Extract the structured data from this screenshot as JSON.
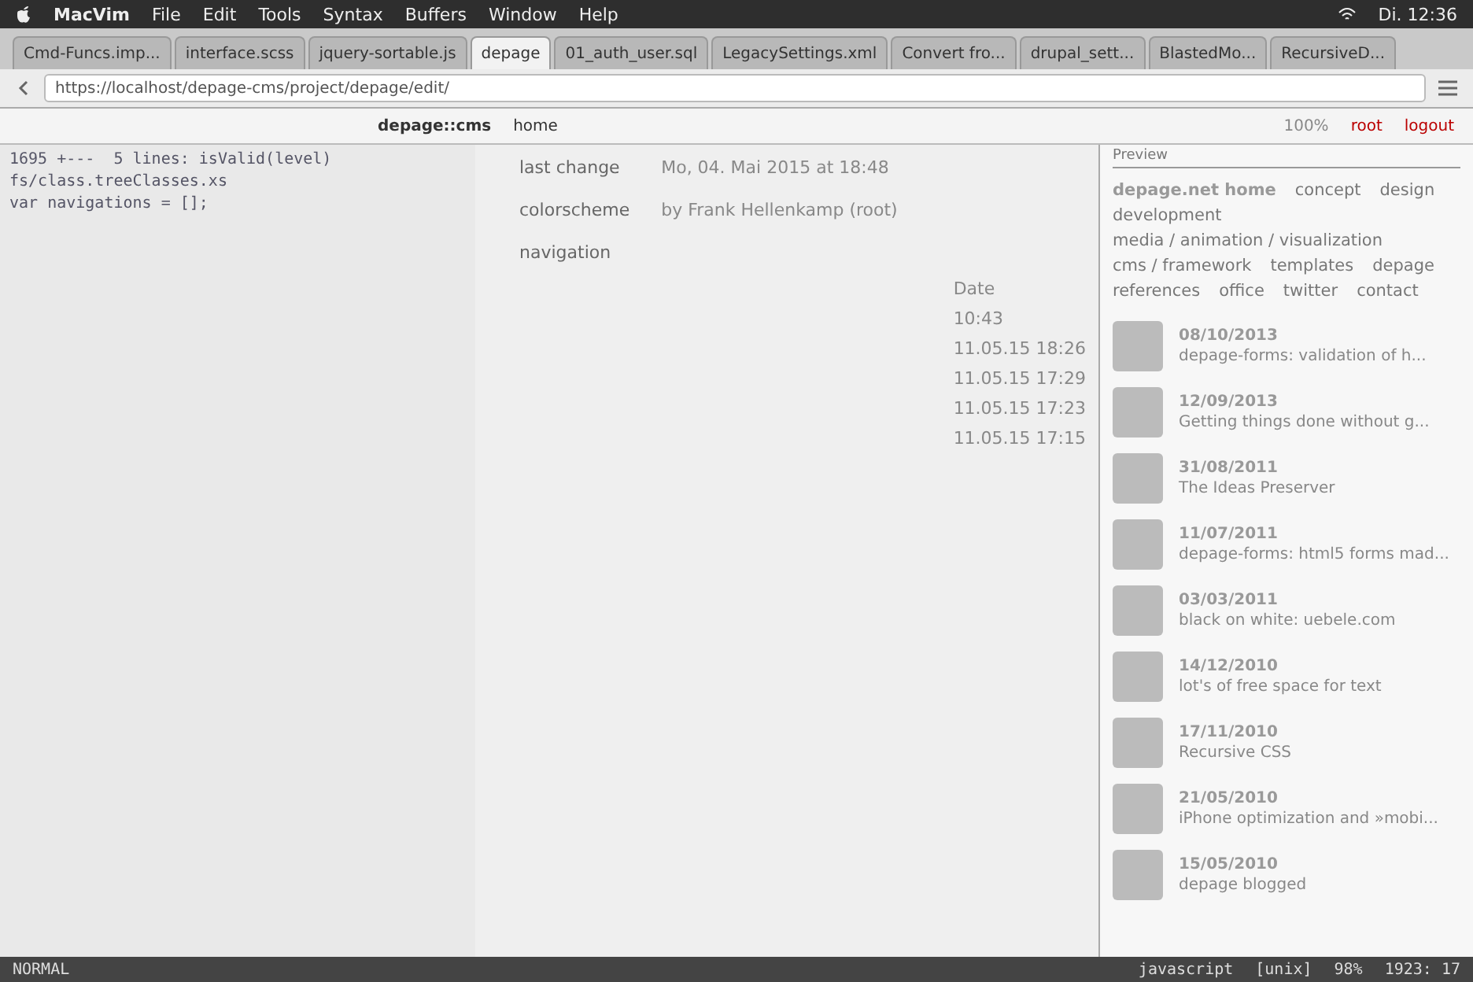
{
  "menubar": {
    "app": "MacVim",
    "menus": [
      "File",
      "Edit",
      "Tools",
      "Syntax",
      "Buffers",
      "Window",
      "Help"
    ],
    "clock": "Di. 12:36"
  },
  "tabs": [
    {
      "label": "Cmd-Funcs.imp...",
      "selected": false
    },
    {
      "label": "interface.scss",
      "selected": false
    },
    {
      "label": "jquery-sortable.js",
      "selected": false
    },
    {
      "label": "depage",
      "selected": true
    },
    {
      "label": "01_auth_user.sql",
      "selected": false
    },
    {
      "label": "LegacySettings.xml",
      "selected": false
    },
    {
      "label": "Convert fro...",
      "selected": false
    },
    {
      "label": "drupal_sett...",
      "selected": false
    },
    {
      "label": "BlastedMo...",
      "selected": false
    },
    {
      "label": "RecursiveD...",
      "selected": false
    }
  ],
  "address_bar": {
    "url": "https://localhost/depage-cms/project/depage/edit/"
  },
  "cms_toolbar": {
    "brand": "depage::cms",
    "home": "home",
    "zoom": "100%",
    "user": "root",
    "logout": "logout"
  },
  "editor": {
    "lines": [
      "1695 +---  5 lines: isValid(level)",
      "fs/class.treeClasses.xs",
      "var navigations = [];"
    ],
    "mode": "NORMAL",
    "filetype": "javascript",
    "format": "[unix]",
    "percent": "98%",
    "position": "1923: 17"
  },
  "tree": {
    "items": [
      "last change",
      "colorscheme",
      "navigation"
    ]
  },
  "page_info": {
    "date": "Mo, 04. Mai 2015 at 18:48",
    "author": "by Frank Hellenkamp (root)"
  },
  "file_list": {
    "header": "Date",
    "rows": [
      "10:43",
      "11.05.15 18:26",
      "11.05.15 17:29",
      "11.05.15 17:23",
      "11.05.15 17:15"
    ]
  },
  "preview": {
    "label": "Preview",
    "nav": [
      "depage.net home",
      "concept",
      "design",
      "development",
      "media / animation / visualization",
      "cms / framework",
      "templates",
      "depage",
      "references",
      "office",
      "twitter",
      "contact"
    ],
    "posts": [
      {
        "date": "08/10/2013",
        "title": "depage-forms: validation of h..."
      },
      {
        "date": "12/09/2013",
        "title": "Getting things done without g..."
      },
      {
        "date": "31/08/2011",
        "title": "The Ideas Preserver"
      },
      {
        "date": "11/07/2011",
        "title": "depage-forms: html5 forms mad..."
      },
      {
        "date": "03/03/2011",
        "title": "black on white: uebele.com"
      },
      {
        "date": "14/12/2010",
        "title": "lot's of free space for text"
      },
      {
        "date": "17/11/2010",
        "title": "Recursive CSS"
      },
      {
        "date": "21/05/2010",
        "title": "iPhone optimization and »mobi..."
      },
      {
        "date": "15/05/2010",
        "title": "depage blogged"
      }
    ]
  }
}
